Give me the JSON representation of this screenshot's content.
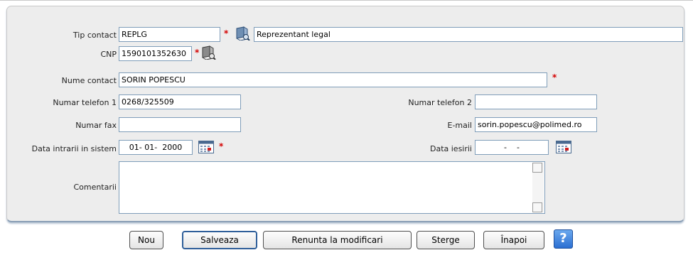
{
  "form": {
    "tip_contact": {
      "label": "Tip contact",
      "code": "REPLG",
      "description": "Reprezentant legal"
    },
    "cnp": {
      "label": "CNP",
      "value": "1590101352630"
    },
    "nume_contact": {
      "label": "Nume contact",
      "value": "SORIN POPESCU"
    },
    "telefon1": {
      "label": "Numar telefon 1",
      "value": "0268/325509"
    },
    "telefon2": {
      "label": "Numar telefon 2",
      "value": ""
    },
    "fax": {
      "label": "Numar fax",
      "value": ""
    },
    "email": {
      "label": "E-mail",
      "value": "sorin.popescu@polimed.ro"
    },
    "data_intrarii": {
      "label": "Data intrarii in sistem",
      "value": "01- 01-  2000"
    },
    "data_iesirii": {
      "label": "Data iesirii",
      "value": "-    -"
    },
    "comentarii": {
      "label": "Comentarii",
      "value": ""
    },
    "required_mark": "*"
  },
  "buttons": {
    "nou": "Nou",
    "salveaza": "Salveaza",
    "renunta": "Renunta la modificari",
    "sterge": "Sterge",
    "inapoi": "Înapoi",
    "help": "?"
  },
  "icons": {
    "lookup": "book-lookup-icon",
    "calendar": "calendar-icon",
    "help": "help-icon"
  },
  "colors": {
    "required": "#d40000",
    "panel": "#ededed",
    "input_border": "#7f9db9",
    "help_button": "#2b6fd2"
  }
}
